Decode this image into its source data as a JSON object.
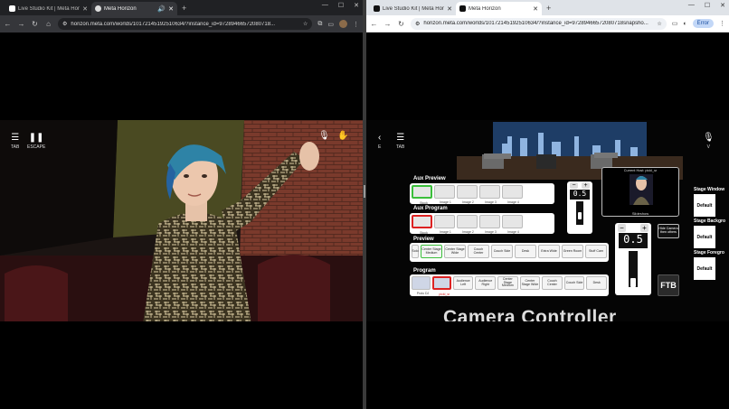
{
  "left_window": {
    "tabs": [
      {
        "title": "Live Studio Kit | Meta Horizon",
        "active": false
      },
      {
        "title": "Meta Horizon",
        "active": true
      }
    ],
    "url": "horizon.meta.com/worlds/1017214519251063​4/?instance_id=97289466572080718...",
    "hud": {
      "tab_label": "TAB",
      "escape_label": "ESCAPE"
    }
  },
  "right_window": {
    "tabs": [
      {
        "title": "Live Studio Kit | Meta Horizon",
        "active": false
      },
      {
        "title": "Meta Horizon",
        "active": true
      }
    ],
    "url": "horizon.meta.com/worlds/1017214519251063​4/?instance_id=97289466572080718snapsho...",
    "error_pill": "Error",
    "hud": {
      "e_label": "E",
      "tab_label": "TAB",
      "v_label": "V"
    },
    "panel": {
      "aux_preview": {
        "label": "Aux Preview",
        "thumbs": [
          "Stock",
          "Image 1",
          "Image 2",
          "Image 3",
          "Image 4"
        ]
      },
      "aux_program": {
        "label": "Aux Program",
        "thumbs": [
          "Stock",
          "Image 1",
          "Image 2",
          "Image 3",
          "Image 4"
        ]
      },
      "aux_fader": {
        "value": "0.5"
      },
      "current_host": {
        "title": "Current Host: pickl_sr",
        "name": "Slideshow"
      },
      "preview": {
        "label": "Preview",
        "buttons": [
          "Solo",
          "Center Stage Medium",
          "Center Stage Wide",
          "Couch Center",
          "Couch Side",
          "Desk",
          "Extra Wide",
          "Green Room",
          "Stuff Cam"
        ],
        "selected_index": 1
      },
      "program": {
        "label": "Program",
        "buttons": [
          "Proto DJ",
          "pickl_sr",
          "Audience Left",
          "Audience Right",
          "Center Stage Medium",
          "Center Stage Wide",
          "Couch Center",
          "Couch Side",
          "Desk"
        ]
      },
      "main_fader": {
        "value": "0.5"
      },
      "hide_camera": "Hide Camera then others",
      "ftb": "FTB",
      "stage_window": {
        "label": "Stage Window",
        "value": "Default"
      },
      "stage_background": {
        "label": "Stage Backgro",
        "value": "Default"
      },
      "stage_foreground": {
        "label": "Stage Foregro",
        "value": "Default"
      },
      "title_text": "Camera Controller"
    }
  },
  "colors": {
    "accent_green": "#3bbf3b",
    "live_red": "#dd2222",
    "chrome_dark": "#202124",
    "chrome_light": "#dfe3e8"
  }
}
